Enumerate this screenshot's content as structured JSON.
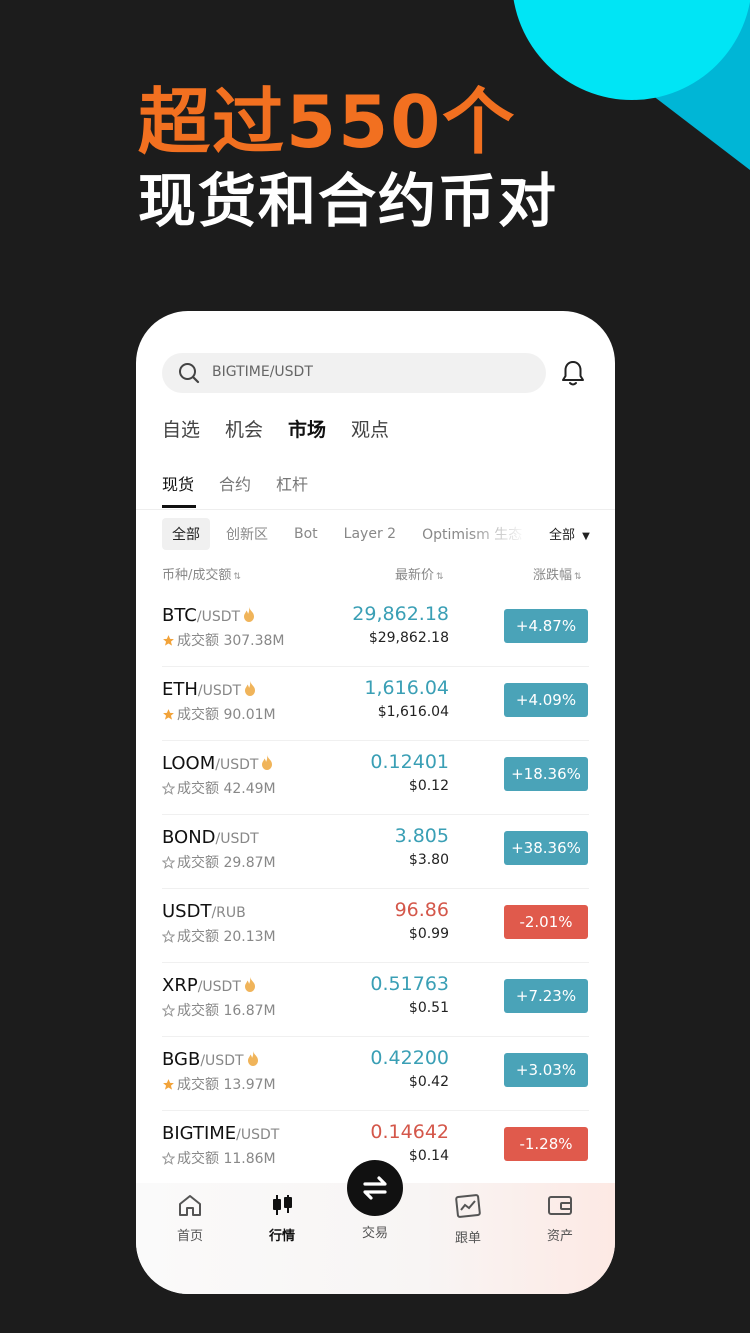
{
  "headline": {
    "line1": "超过550个",
    "line2": "现货和合约币对"
  },
  "search": {
    "placeholder": "BIGTIME/USDT"
  },
  "main_tabs": [
    "自选",
    "机会",
    "市场",
    "观点"
  ],
  "sub_tabs": [
    "现货",
    "合约",
    "杠杆"
  ],
  "chips": [
    "全部",
    "创新区",
    "Bot",
    "Layer 2",
    "Optimism 生态"
  ],
  "filter": "全部",
  "columns": {
    "pair": "币种/成交额",
    "price": "最新价",
    "change": "涨跌幅"
  },
  "rows": [
    {
      "base": "BTC",
      "quote": "/USDT",
      "hot": true,
      "fav": true,
      "vol": "成交额 307.38M",
      "price": "29,862.18",
      "usd": "$29,862.18",
      "change": "+4.87%",
      "up": true
    },
    {
      "base": "ETH",
      "quote": "/USDT",
      "hot": true,
      "fav": true,
      "vol": "成交额 90.01M",
      "price": "1,616.04",
      "usd": "$1,616.04",
      "change": "+4.09%",
      "up": true
    },
    {
      "base": "LOOM",
      "quote": "/USDT",
      "hot": true,
      "fav": false,
      "vol": "成交额 42.49M",
      "price": "0.12401",
      "usd": "$0.12",
      "change": "+18.36%",
      "up": true
    },
    {
      "base": "BOND",
      "quote": "/USDT",
      "hot": false,
      "fav": false,
      "vol": "成交额 29.87M",
      "price": "3.805",
      "usd": "$3.80",
      "change": "+38.36%",
      "up": true
    },
    {
      "base": "USDT",
      "quote": "/RUB",
      "hot": false,
      "fav": false,
      "vol": "成交额 20.13M",
      "price": "96.86",
      "usd": "$0.99",
      "change": "-2.01%",
      "up": false
    },
    {
      "base": "XRP",
      "quote": "/USDT",
      "hot": true,
      "fav": false,
      "vol": "成交额 16.87M",
      "price": "0.51763",
      "usd": "$0.51",
      "change": "+7.23%",
      "up": true
    },
    {
      "base": "BGB",
      "quote": "/USDT",
      "hot": true,
      "fav": true,
      "vol": "成交额 13.97M",
      "price": "0.42200",
      "usd": "$0.42",
      "change": "+3.03%",
      "up": true
    },
    {
      "base": "BIGTIME",
      "quote": "/USDT",
      "hot": false,
      "fav": false,
      "vol": "成交额 11.86M",
      "price": "0.14642",
      "usd": "$0.14",
      "change": "-1.28%",
      "up": false
    }
  ],
  "nav": {
    "home": "首页",
    "market": "行情",
    "trade": "交易",
    "copy": "跟单",
    "assets": "资产"
  },
  "colors": {
    "accent": "#f27020",
    "up": "#3a9fb5",
    "up_bg": "#4aa3b8",
    "down": "#d4574a",
    "down_bg": "#e05a4c",
    "star": "#f2a33a",
    "hot": "#f0b45a",
    "cyan": "#00d8f0"
  }
}
